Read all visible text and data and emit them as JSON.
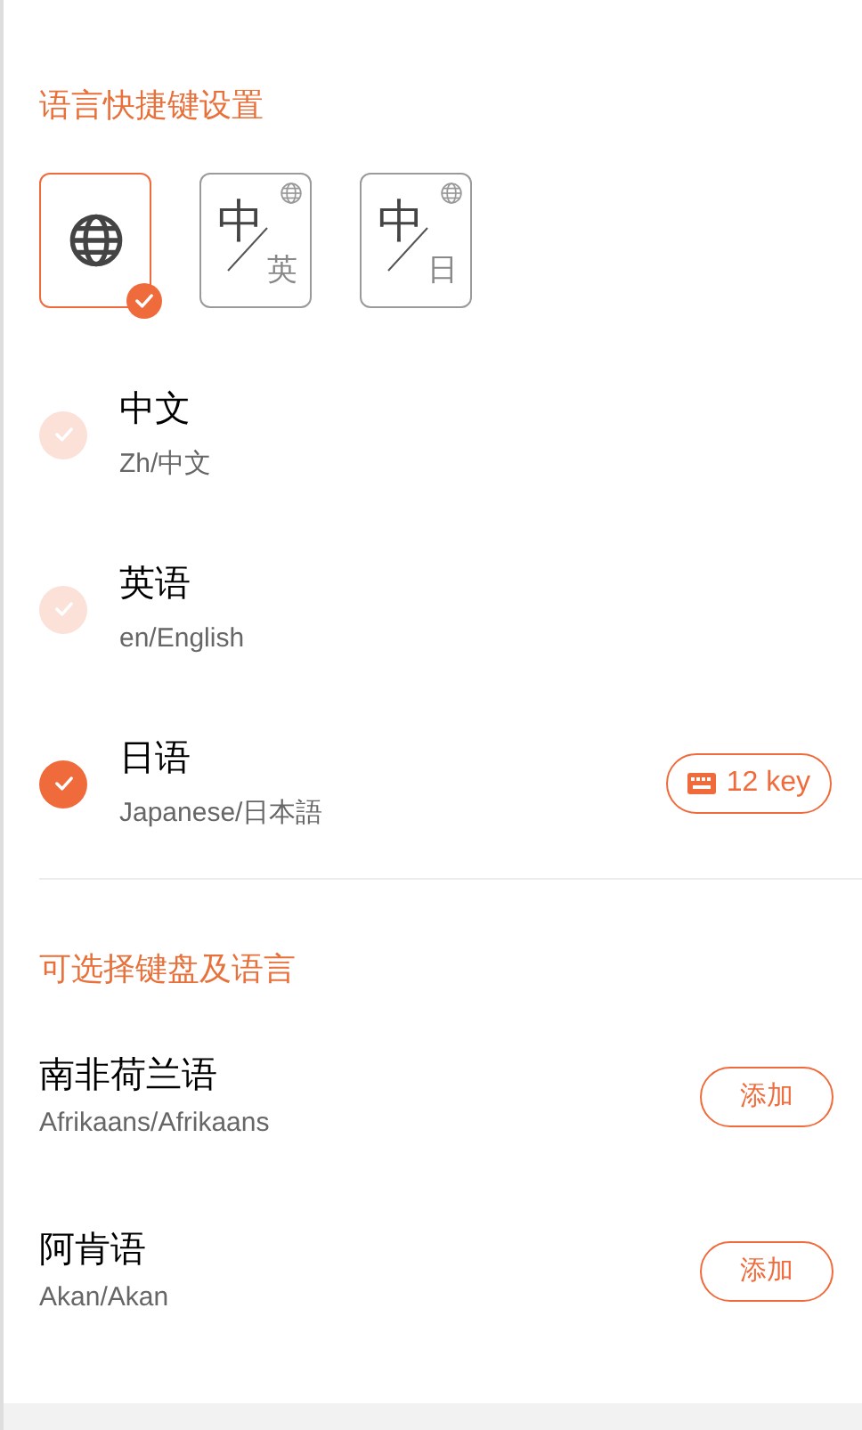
{
  "shortcut_section": {
    "title": "语言快捷键设置",
    "modes": [
      {
        "kind": "globe",
        "selected": true
      },
      {
        "kind": "pair",
        "main": "中",
        "sub": "英",
        "selected": false
      },
      {
        "kind": "pair",
        "main": "中",
        "sub": "日",
        "selected": false
      }
    ]
  },
  "languages": [
    {
      "name": "中文",
      "code": "Zh/中文",
      "checked": false
    },
    {
      "name": "英语",
      "code": "en/English",
      "checked": false
    },
    {
      "name": "日语",
      "code": "Japanese/日本語",
      "checked": true,
      "badge": "12 key"
    }
  ],
  "available_section": {
    "title": "可选择键盘及语言",
    "items": [
      {
        "name": "南非荷兰语",
        "code": "Afrikaans/Afrikaans",
        "action": "添加"
      },
      {
        "name": "阿肯语",
        "code": "Akan/Akan",
        "action": "添加"
      }
    ]
  }
}
